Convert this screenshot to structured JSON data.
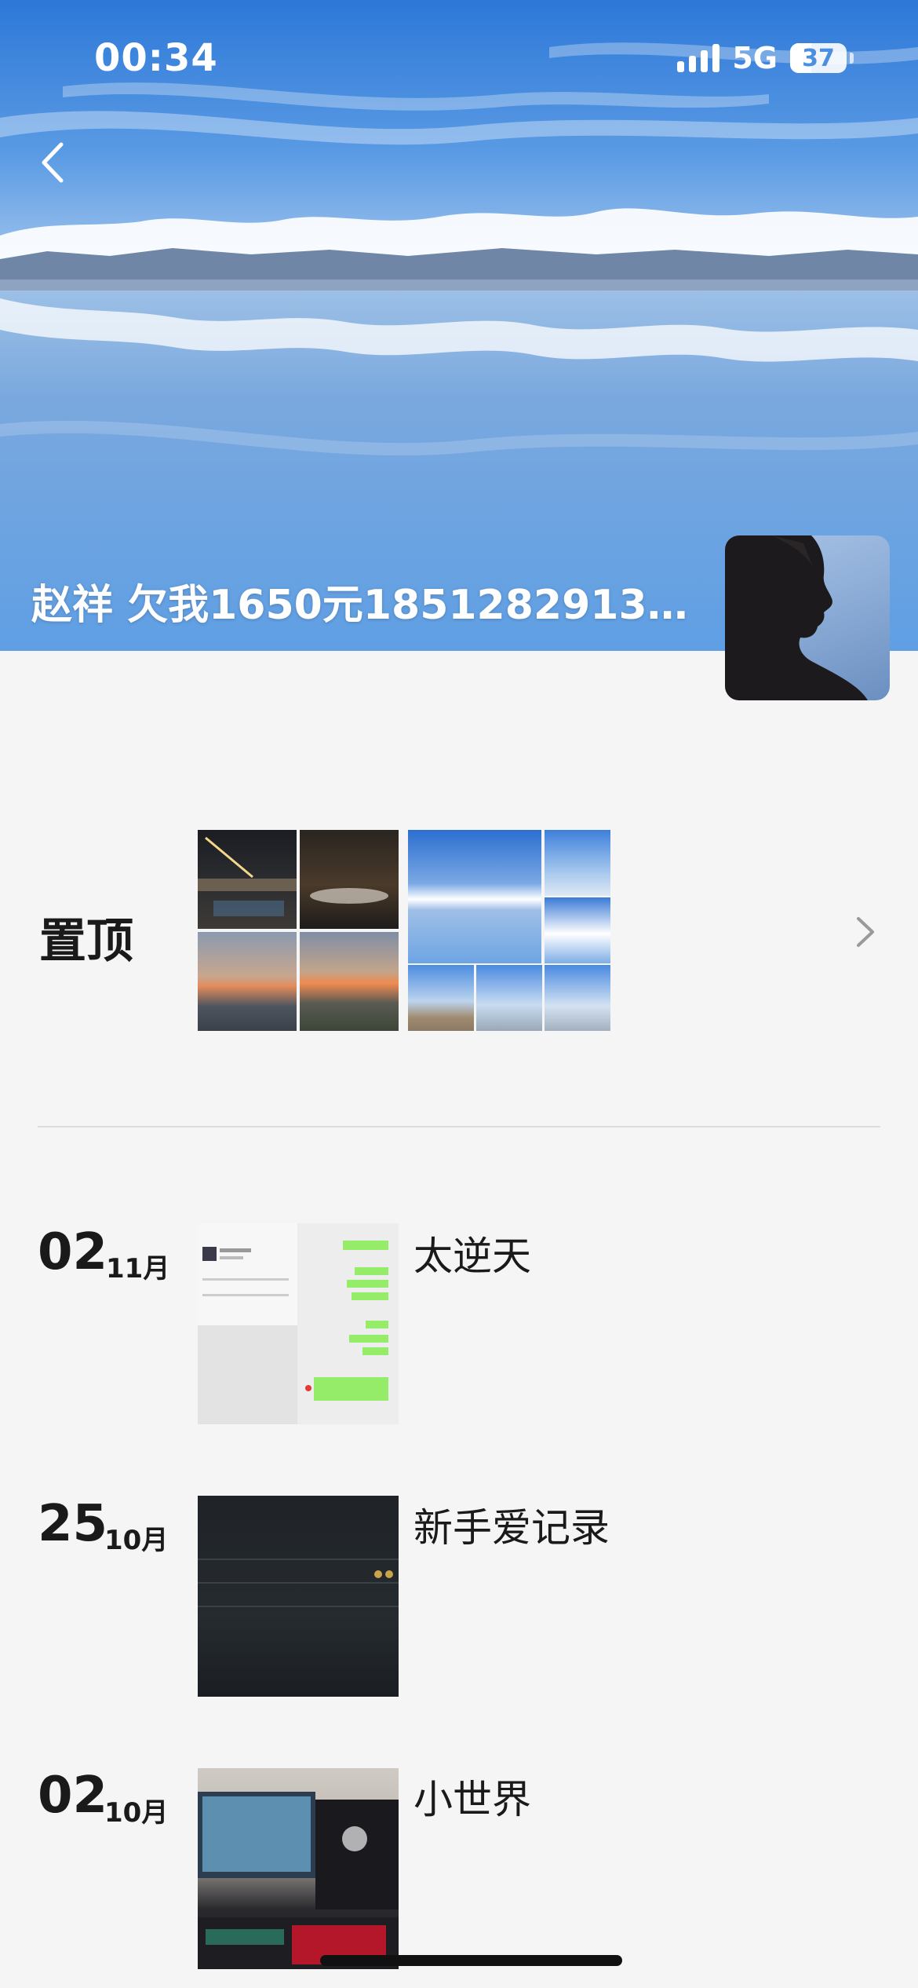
{
  "status_bar": {
    "time": "00:34",
    "network": "5G",
    "battery": "37",
    "battery_level": 0.37
  },
  "header": {
    "back_icon": "chevron-left-icon",
    "title": "赵祥 欠我1650元18512829135..."
  },
  "pinned": {
    "label": "置顶",
    "chevron_icon": "chevron-right-icon"
  },
  "posts": [
    {
      "day": "02",
      "month": "11月",
      "text": "太逆天"
    },
    {
      "day": "25",
      "month": "10月",
      "text": "新手爱记录"
    },
    {
      "day": "02",
      "month": "10月",
      "text": "小世界"
    }
  ],
  "colors": {
    "page_bg": "#f5f5f5",
    "sky": "#4a92e0",
    "text": "#1a1a1a",
    "divider": "#dcdcdc"
  }
}
